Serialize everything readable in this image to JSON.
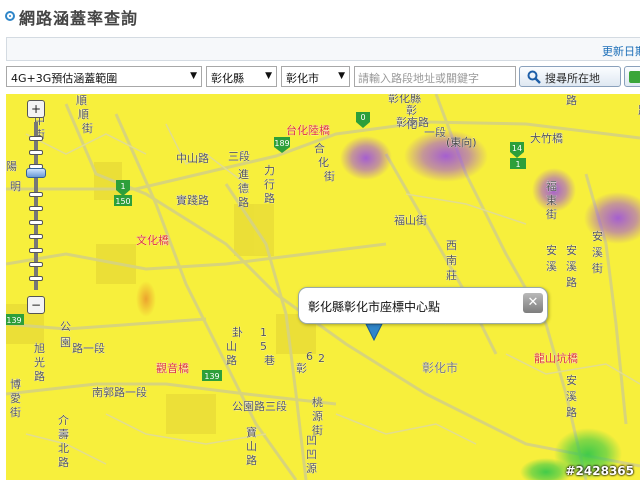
{
  "page": {
    "title": "網路涵蓋率查詢",
    "update_label": "更新日期"
  },
  "toolbar": {
    "coverage_type": "4G+3G預估涵蓋範圍",
    "county": "彰化縣",
    "city": "彰化市",
    "address_placeholder": "請輸入路段地址或關鍵字",
    "locate_label": "搜尋所在地"
  },
  "map": {
    "popup_text": "彰化縣彰化市座標中心點",
    "watermark": "#2428365",
    "zoom": {
      "in": "+",
      "out": "−"
    },
    "road_numbers": [
      "0",
      "189",
      "1",
      "150",
      "139",
      "14",
      "1",
      "139"
    ],
    "labels": [
      "彰",
      "化",
      "縣",
      "立",
      "體",
      "育",
      "場",
      "縣",
      "民",
      "公",
      "園",
      "彰",
      "南",
      "路",
      "一",
      "段",
      "(",
      "東",
      "向",
      ")",
      "台",
      "化",
      "陸",
      "橋",
      "合",
      "化",
      "街",
      "大",
      "竹",
      "橋",
      "中",
      "山",
      "路",
      "三",
      "段",
      "進",
      "德",
      "路",
      "力",
      "行",
      "路",
      "福",
      "東",
      "街",
      "福",
      "山",
      "街",
      "西",
      "南",
      "莊",
      "文",
      "化",
      "橋",
      "實",
      "踐",
      "路",
      "安",
      "溪",
      "路",
      "安",
      "溪",
      "溪",
      "街",
      "公",
      "園",
      "路",
      "一",
      "段",
      "卦",
      "山",
      "路",
      "1",
      "5",
      "巷",
      "6",
      "2",
      "彰",
      "化",
      "市",
      "旭",
      "光",
      "路",
      "觀",
      "音",
      "橋",
      "南",
      "郭",
      "路",
      "一",
      "段",
      "博",
      "愛",
      "街",
      "介",
      "壽",
      "北",
      "路",
      "公",
      "園",
      "路",
      "三",
      "段",
      "桃",
      "源",
      "街",
      "寶",
      "山",
      "路",
      "凹",
      "凹",
      "源",
      "路",
      "彰",
      "化",
      "縣",
      "路",
      "安",
      "溪",
      "路",
      "龍",
      "山",
      "坑",
      "橋"
    ]
  },
  "colors": {
    "coverage_4g": "#f7ef3c",
    "coverage_high": "#9c4fe0",
    "coverage_low": "#39c94a",
    "accent": "#2f86c9"
  }
}
